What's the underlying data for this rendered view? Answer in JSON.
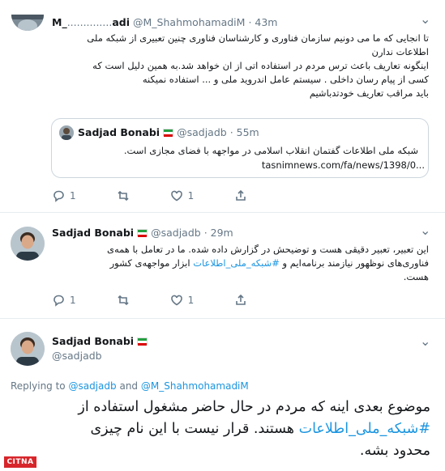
{
  "tweet1": {
    "name": "M_",
    "name_dots": "..............",
    "name_end": "adi",
    "handle": "@M_ShahmohamadiM",
    "time": "· 43m",
    "lines": [
      "تا انجایی که ما می دونیم سازمان فناوری و کارشناسان فناوری چنین تعبیری از شبکه ملی",
      "اطلاعات ندارن",
      "اینگونه تعاریف باعث ترس مردم در استفاده اتی از ان خواهد شد.به همین دلیل است که",
      "کسی از پیام رسان داخلی  . سیستم عامل اندروید ملی و ... استفاده نمیکنه",
      "باید مراقب تعاریف خودتدباشیم"
    ],
    "quote": {
      "name": "Sadjad Bonabi",
      "handle": "@sadjadb",
      "time": "· 55m",
      "text": "شبکه ملی اطلاعات گفتمان انقلاب اسلامی در مواجهه با فضای مجازی است.",
      "link": "tasnimnews.com/fa/news/1398/0..."
    },
    "reply_count": "1",
    "like_count": "1"
  },
  "tweet2": {
    "name": "Sadjad Bonabi",
    "handle": "@sadjadb",
    "time": "· 29m",
    "line1": "این تعبیر، تعبیر دقیقی هست و توضیحش در گزارش داده شده. ما در تعامل با همه‌ی",
    "line2_a": "فناوری‌های نوظهور نیازمند برنامه‌ایم و ",
    "line2_hashtag": "#شبکه_ملی_اطلاعات",
    "line2_b": " ابزار مواجهه‌ی کشور",
    "line3": "هست.",
    "reply_count": "1",
    "like_count": "1"
  },
  "tweet3": {
    "name": "Sadjad Bonabi",
    "handle": "@sadjadb",
    "replying_prefix": "Replying to",
    "replying_user1": "@sadjadb",
    "replying_and": "and",
    "replying_user2": "@M_ShahmohamadiM",
    "line1": "موضوع بعدی اینه که مردم در حال حاضر مشغول استفاده از",
    "line2_hashtag": "#شبکه_ملی_اطلاعات",
    "line2_b": " هستند. قرار نیست با این نام چیزی",
    "line3": "محدود بشه."
  },
  "watermark": "CITNA",
  "colors": {
    "link": "#1b95e0",
    "muted": "#657786",
    "border": "#e6ecf0",
    "flag_green": "#239f40",
    "flag_red": "#da0000"
  }
}
